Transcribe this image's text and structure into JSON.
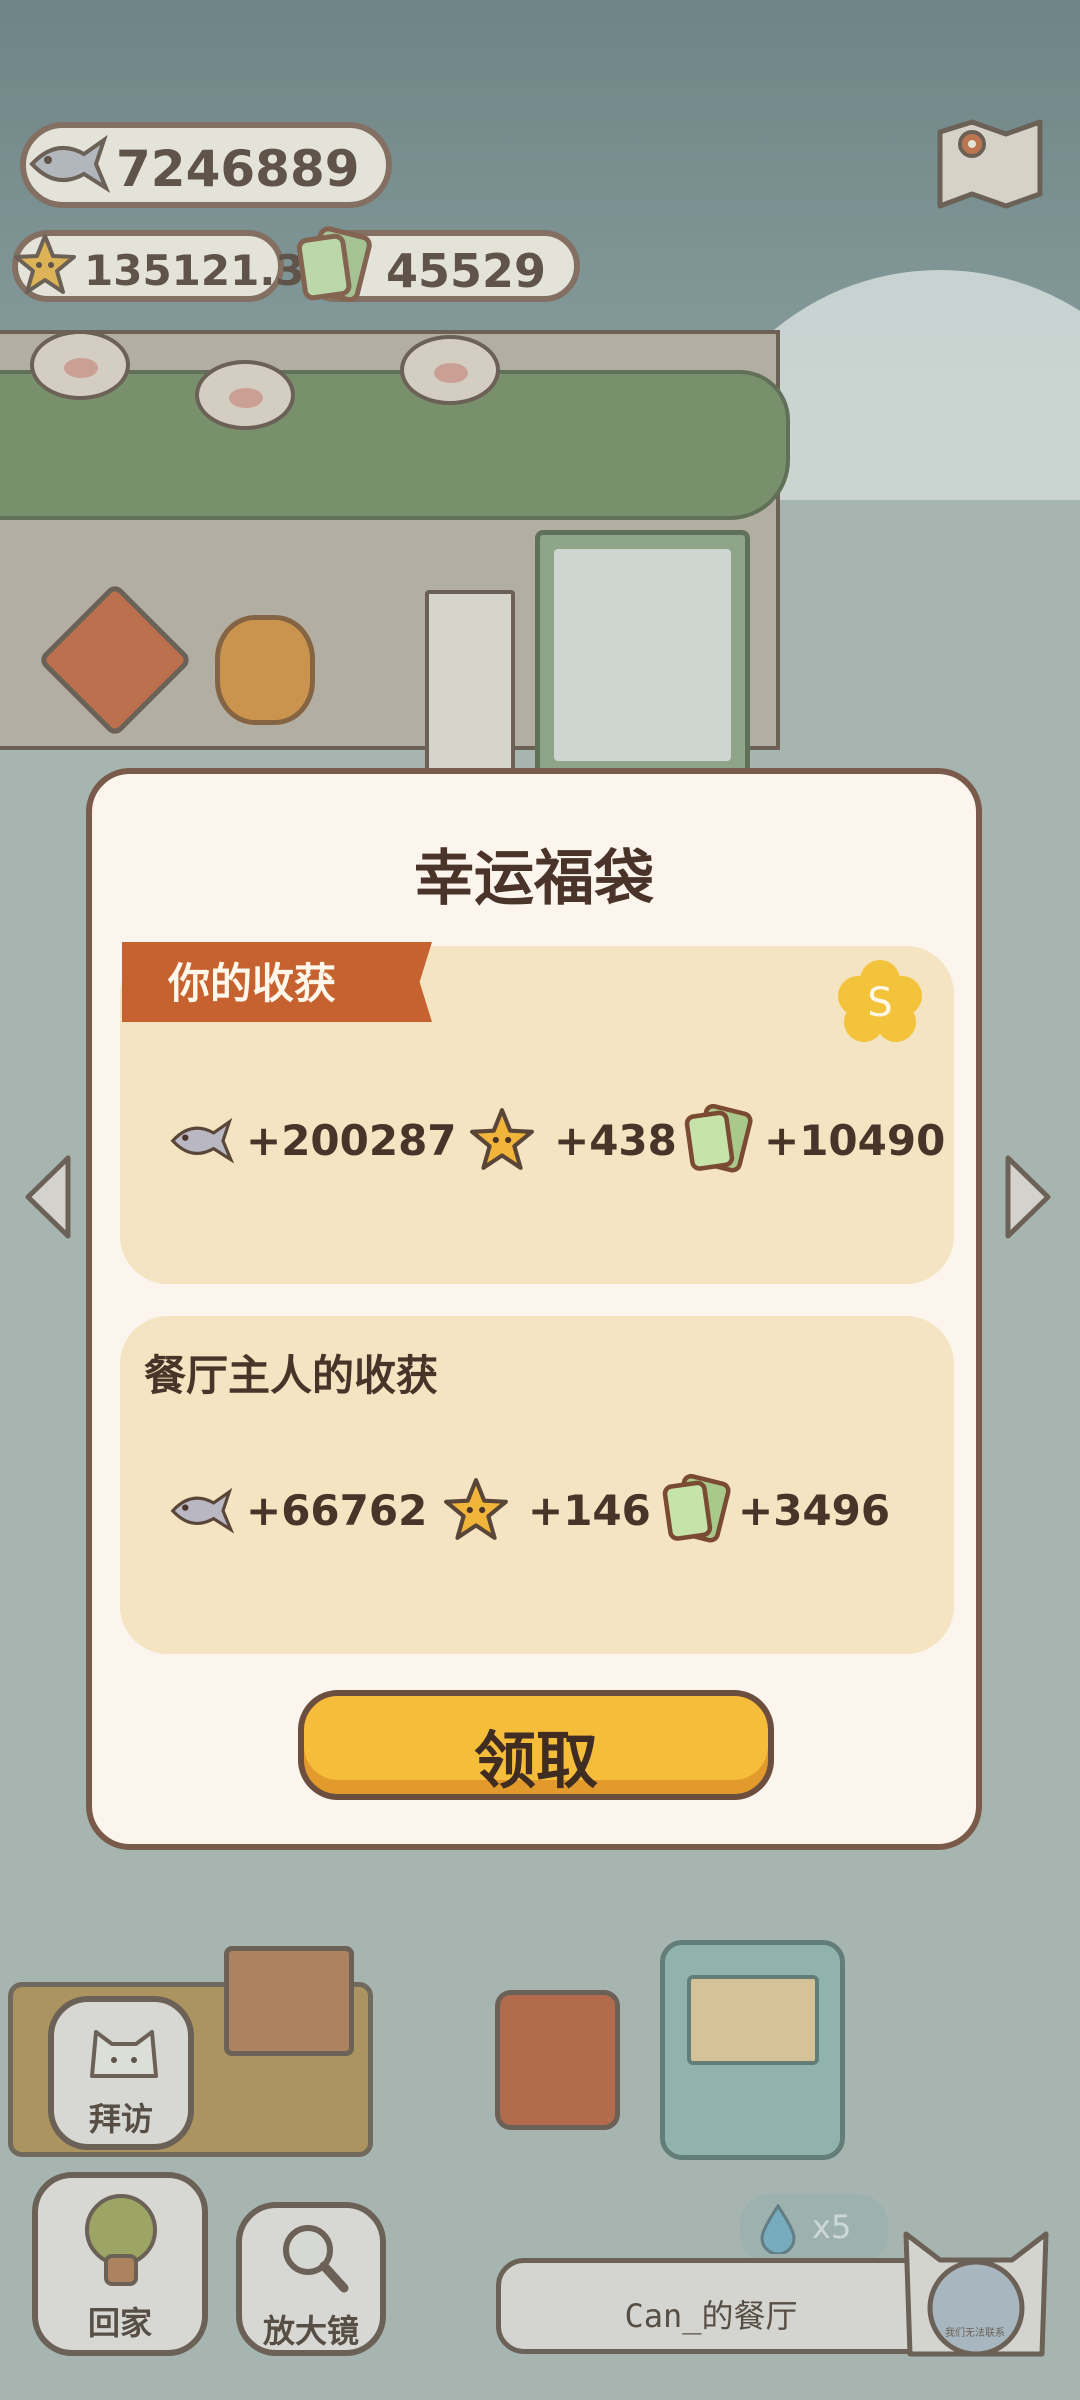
{
  "hud": {
    "fish": "7246889",
    "stars": "135121.3",
    "tickets": "45529"
  },
  "icons": {
    "fish": "fish-icon",
    "star": "star-icon",
    "ticket": "ticket-icon",
    "map": "map-icon",
    "badge": "s-badge-icon"
  },
  "modal": {
    "title": "幸运福袋",
    "your_harvest": {
      "label": "你的收获",
      "fish": "+200287",
      "stars": "+438",
      "tickets": "+10490"
    },
    "owner_harvest": {
      "label": "餐厅主人的收获",
      "fish": "+66762",
      "stars": "+146",
      "tickets": "+3496"
    },
    "claim_label": "领取"
  },
  "bottom": {
    "visit_label": "拜访",
    "home_label": "回家",
    "zoom_label": "放大镜",
    "drop_count": "x5",
    "restaurant_name": "Can_的餐厅",
    "avatar_caption": "我们无法联系"
  },
  "colors": {
    "accent_orange": "#c6622f",
    "button_yellow": "#f5bd3a",
    "card_bg": "#f4e4c2",
    "border_brown": "#7a5a4a"
  }
}
